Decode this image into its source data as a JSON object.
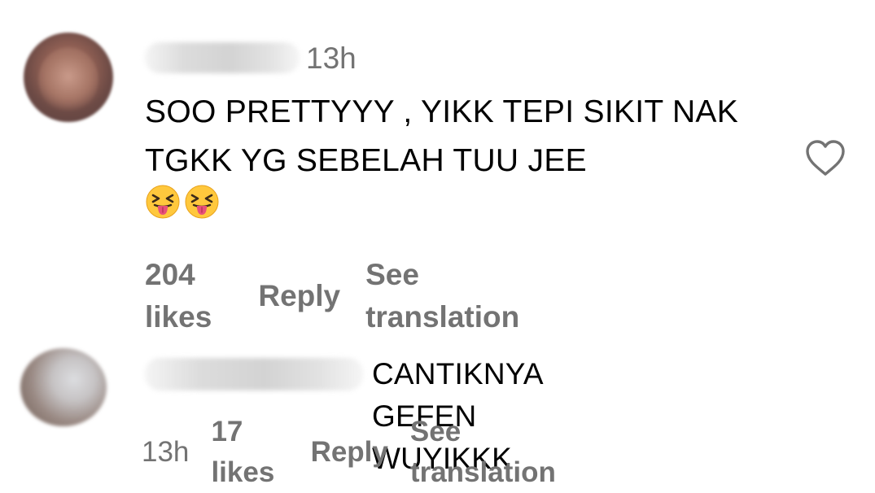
{
  "comments": [
    {
      "timestamp": "13h",
      "text": "SOO PRETTYYY , YIKK TEPI SIKIT NAK TGKK YG SEBELAH TUU JEE",
      "emojis": [
        "face-with-tongue-squinting-icon",
        "face-with-tongue-squinting-icon"
      ],
      "likes_label": "204 likes",
      "reply_label": "Reply",
      "translation_label": "See translation",
      "like_icon": "heart-outline-icon"
    },
    {
      "timestamp": "13h",
      "text": "CANTIKNYA GEFEN WUYIKKK",
      "likes_label": "17 likes",
      "reply_label": "Reply",
      "translation_label": "See translation"
    }
  ],
  "colors": {
    "text": "#000000",
    "secondary": "#737373",
    "heart_stroke": "#737373",
    "emoji_face": "#FFC83D",
    "emoji_tongue": "#E8507A"
  }
}
